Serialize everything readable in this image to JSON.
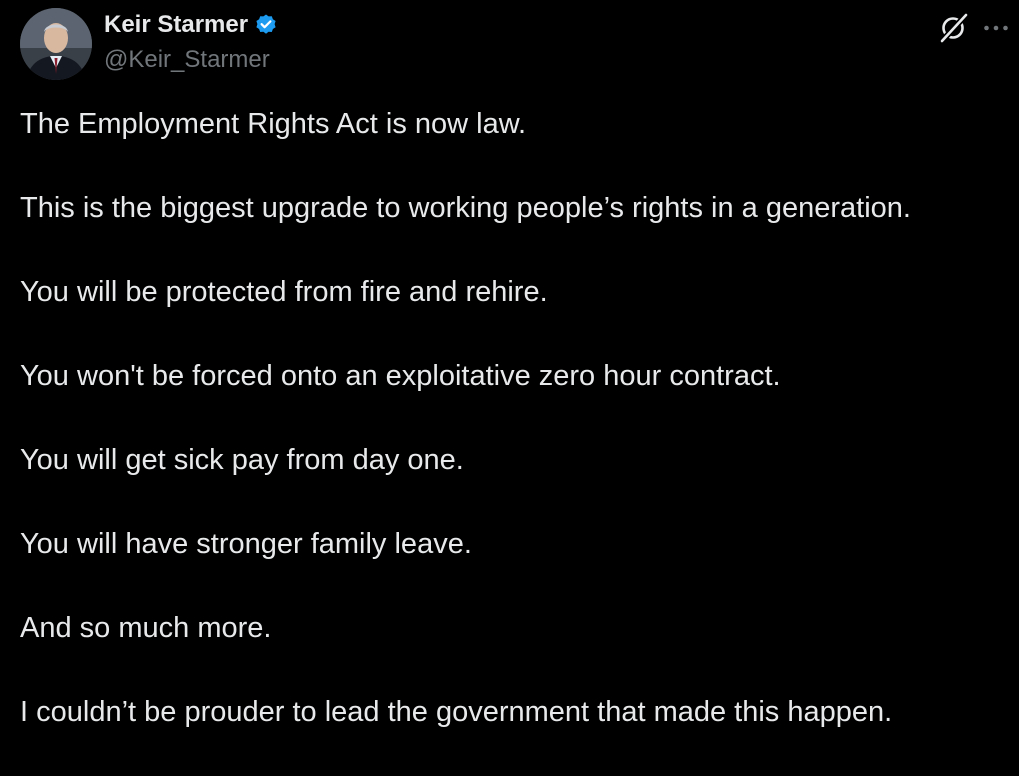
{
  "author": {
    "display_name": "Keir Starmer",
    "handle": "@Keir_Starmer",
    "verified": true,
    "verified_badge_color": "#1d9bf0",
    "avatar_icon": "profile-photo"
  },
  "actions": {
    "grok_icon": "grok-icon",
    "more_icon": "more-horizontal-icon"
  },
  "post": {
    "lines": [
      "The Employment Rights Act is now law.",
      "This is the biggest upgrade to working people’s rights in a generation.",
      "You will be protected from fire and rehire.",
      "You won't be forced onto an exploitative zero hour contract.",
      "You will get sick pay from day one.",
      "You will have stronger family leave.",
      "And so much more.",
      "I couldn’t be prouder to lead the government that made this happen."
    ]
  },
  "colors": {
    "background": "#000000",
    "text_primary": "#e7e9ea",
    "text_secondary": "#71767b"
  }
}
